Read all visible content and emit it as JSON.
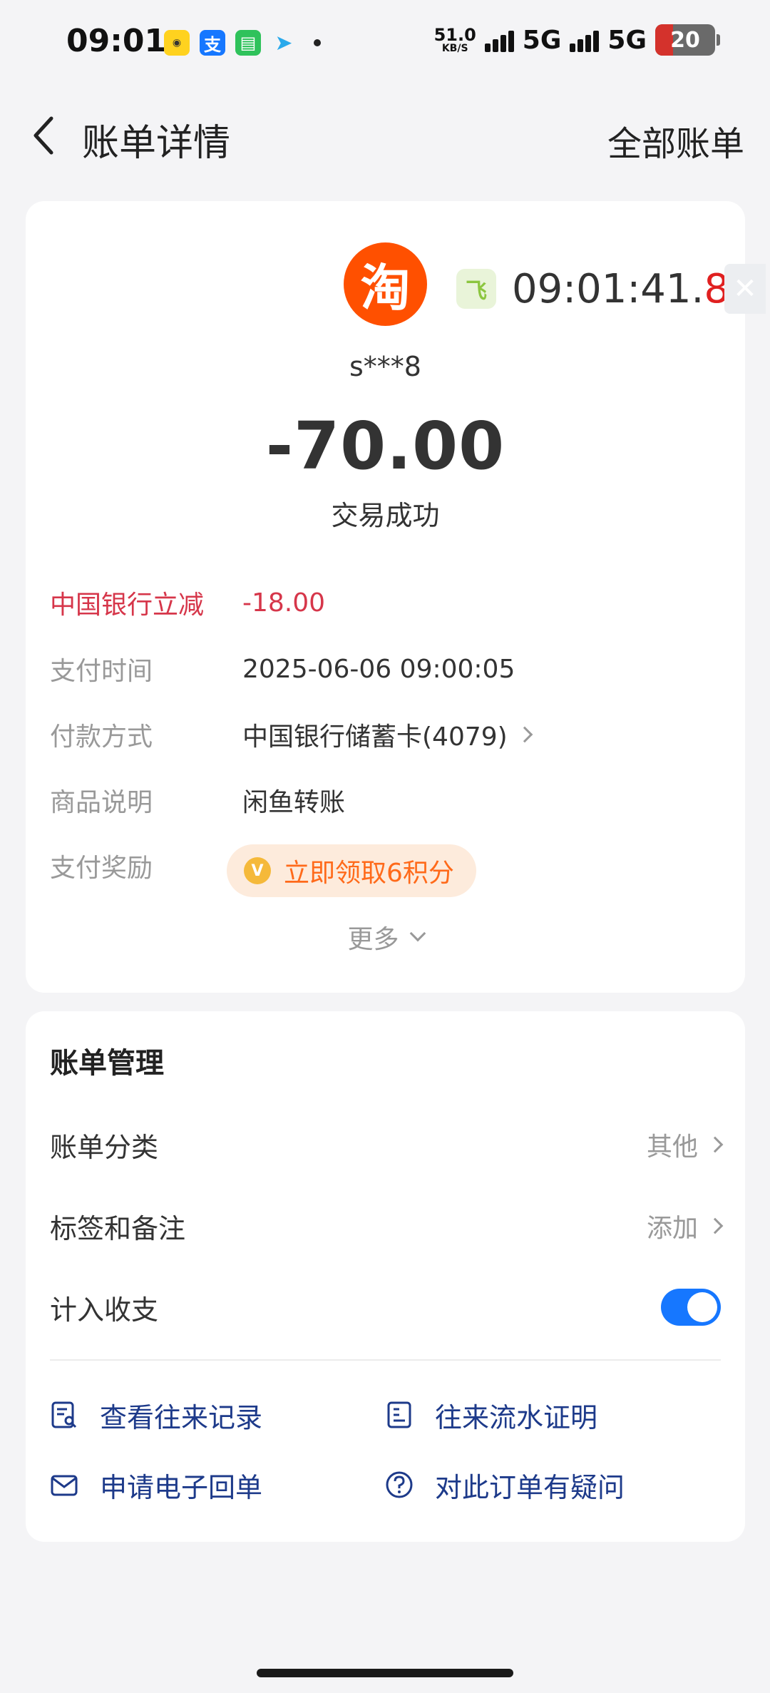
{
  "status_bar": {
    "time": "09:01",
    "net_speed_value": "51.0",
    "net_speed_unit": "KB/S",
    "network_1": "5G",
    "network_2": "5G",
    "battery": "20"
  },
  "nav": {
    "title": "账单详情",
    "right_link": "全部账单"
  },
  "transaction": {
    "merchant_logo_char": "淘",
    "merchant_name": "s***8",
    "amount": "-70.00",
    "status": "交易成功"
  },
  "details": {
    "discount": {
      "label": "中国银行立减",
      "value": "-18.00"
    },
    "pay_time": {
      "label": "支付时间",
      "value": "2025-06-06 09:00:05"
    },
    "pay_method": {
      "label": "付款方式",
      "value": "中国银行储蓄卡(4079)"
    },
    "description": {
      "label": "商品说明",
      "value": "闲鱼转账"
    },
    "reward": {
      "label": "支付奖励",
      "value": "立即领取6积分",
      "coin_char": "V"
    },
    "more": "更多"
  },
  "float_timer": {
    "time_main": "09:01:41.",
    "time_ms": "8",
    "icon_char": "飞",
    "close_char": "✕"
  },
  "management": {
    "title": "账单管理",
    "category": {
      "label": "账单分类",
      "value": "其他"
    },
    "tags": {
      "label": "标签和备注",
      "value": "添加"
    },
    "include": {
      "label": "计入收支",
      "enabled": true
    }
  },
  "links": {
    "records": "查看往来记录",
    "proof": "往来流水证明",
    "receipt": "申请电子回单",
    "question": "对此订单有疑问"
  },
  "colors": {
    "accent_blue": "#1677ff",
    "link_blue": "#1d3a8a",
    "discount_red": "#d6364a",
    "reward_orange": "#ff6a1a",
    "taobao_orange": "#ff5000"
  }
}
